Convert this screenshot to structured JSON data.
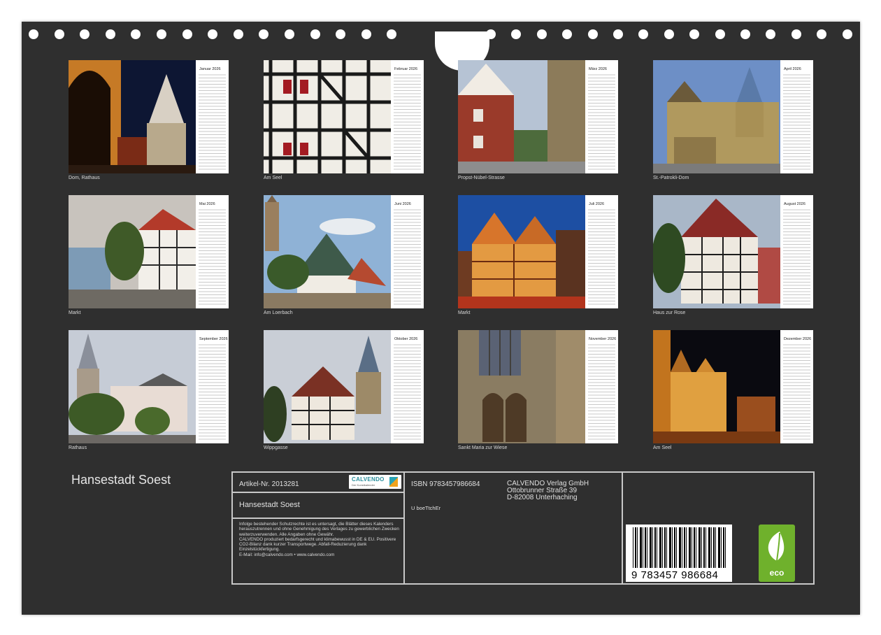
{
  "calendar": {
    "months": [
      {
        "month": "Januar 2026",
        "caption": "Dom, Rathaus"
      },
      {
        "month": "Februar 2026",
        "caption": "Am Seel"
      },
      {
        "month": "März 2026",
        "caption": "Propst-Nübel-Strasse"
      },
      {
        "month": "April 2026",
        "caption": "St.-Patrokli-Dom"
      },
      {
        "month": "Mai 2026",
        "caption": "Markt"
      },
      {
        "month": "Juni 2026",
        "caption": "Am Loerbach"
      },
      {
        "month": "Juli 2026",
        "caption": "Markt"
      },
      {
        "month": "August 2026",
        "caption": "Haus zur Rose"
      },
      {
        "month": "September 2026",
        "caption": "Rathaus"
      },
      {
        "month": "Oktober 2026",
        "caption": "Wippgasse"
      },
      {
        "month": "November 2026",
        "caption": "Sankt Maria zur Wiese"
      },
      {
        "month": "Dezember 2026",
        "caption": "Am Seel"
      }
    ]
  },
  "title": "Hansestadt Soest",
  "info": {
    "article": "Artikel-Nr. 2013281",
    "title": "Hansestadt Soest",
    "logo_word": "CALVENDO",
    "logo_sub": "Der Kunstkalender",
    "legal_1": "Infolge bestehender Schutzrechte ist es untersagt, die Blätter dieses Kalenders herauszutrennen und ohne Genehmigung des Verlages zu gewerblichen Zwecken weiterzuverwenden. Alle Angaben ohne Gewähr.",
    "legal_2": "CALVENDO produziert bedarfsgerecht und klimabewusst in DE & EU. Positivere CO2-Bilanz dank kurzer Transportwege. Abfall-Reduzierung dank Einzelstückfertigung.",
    "legal_3": "E-Mail: info@calvendo.com • www.calvendo.com",
    "isbn": "ISBN 9783457986684",
    "code": "U boeTtchEr",
    "publisher_1": "CALVENDO Verlag GmbH",
    "publisher_2": "Ottobrunner Straße 39",
    "publisher_3": "D-82008 Unterhaching",
    "barcode_digits": "9 783457 986684",
    "eco_label": "eco"
  }
}
